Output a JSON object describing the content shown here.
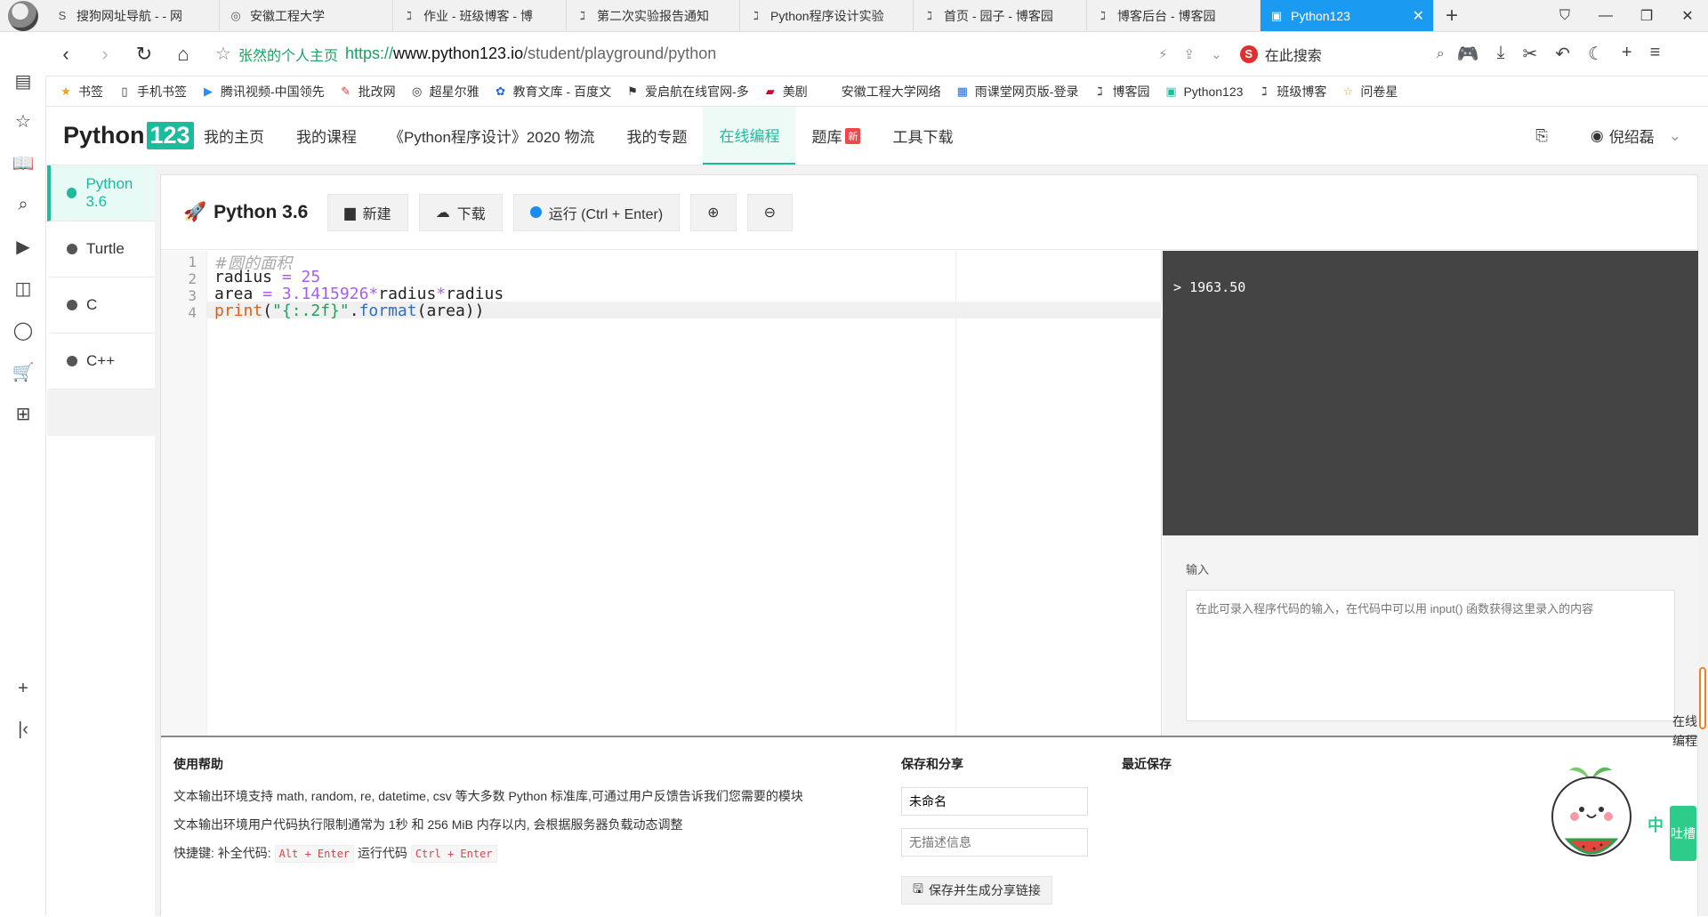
{
  "browser": {
    "tabs": [
      {
        "icon": "sogou-icon",
        "title": "搜狗网址导航 - - 网"
      },
      {
        "icon": "globe-icon",
        "title": "安徽工程大学"
      },
      {
        "icon": "cnblogs-icon",
        "title": "作业 - 班级博客 - 博"
      },
      {
        "icon": "cnblogs-icon",
        "title": "第二次实验报告通知"
      },
      {
        "icon": "cnblogs-icon",
        "title": "Python程序设计实验"
      },
      {
        "icon": "cnblogs-icon",
        "title": "首页 - 园子 - 博客园"
      },
      {
        "icon": "cnblogs-icon",
        "title": "博客后台 - 博客园"
      },
      {
        "icon": "python123-icon",
        "title": "Python123",
        "active": true
      }
    ],
    "site_title": "张然的个人主页",
    "url_proto": "https://",
    "url_host": "www.python123.io",
    "url_path": "/student/playground/python",
    "search_placeholder": "在此搜索",
    "bookmarks": [
      {
        "icon": "star-icon",
        "label": "书签"
      },
      {
        "icon": "phone-icon",
        "label": "手机书签"
      },
      {
        "icon": "tencent-video-icon",
        "label": "腾讯视频-中国领先"
      },
      {
        "icon": "pigai-icon",
        "label": "批改网"
      },
      {
        "icon": "globe-icon",
        "label": "超星尔雅"
      },
      {
        "icon": "baidu-icon",
        "label": "教育文库 - 百度文"
      },
      {
        "icon": "flag-icon",
        "label": "爱启航在线官网-多"
      },
      {
        "icon": "meiju-icon",
        "label": "美剧"
      },
      {
        "icon": "blank-icon",
        "label": "安徽工程大学网络"
      },
      {
        "icon": "rain-icon",
        "label": "雨课堂网页版-登录"
      },
      {
        "icon": "cnblogs-icon",
        "label": "博客园"
      },
      {
        "icon": "python123-icon",
        "label": "Python123"
      },
      {
        "icon": "cnblogs-icon",
        "label": "班级博客"
      },
      {
        "icon": "star-icon",
        "label": "问卷星"
      }
    ]
  },
  "site": {
    "logo_text": "Python",
    "logo_num": "123",
    "nav": [
      "我的主页",
      "我的课程",
      "《Python程序设计》2020 物流",
      "我的专题",
      "在线编程",
      "题库",
      "工具下载"
    ],
    "nav_active": "在线编程",
    "new_badge": "新",
    "username": "倪绍磊"
  },
  "languages": [
    {
      "label": "Python 3.6",
      "active": true
    },
    {
      "label": "Turtle"
    },
    {
      "label": "C"
    },
    {
      "label": "C++"
    }
  ],
  "toolbar": {
    "title": "Python 3.6",
    "new_label": "新建",
    "download_label": "下载",
    "run_label": "运行 (Ctrl + Enter)"
  },
  "editor": {
    "line_numbers": [
      "1",
      "2",
      "3",
      "4"
    ],
    "comment": "#圆的面积"
  },
  "output": {
    "prompt": ">",
    "result": "1963.50"
  },
  "input": {
    "label": "输入",
    "placeholder": "在此可录入程序代码的输入，在代码中可以用 input() 函数获得这里录入的内容"
  },
  "help": {
    "title": "使用帮助",
    "line1": "文本输出环境支持 math, random, re, datetime, csv 等大多数 Python 标准库,可通过用户反馈告诉我们您需要的模块",
    "line2": "文本输出环境用户代码执行限制通常为 1秒 和 256 MiB 内存以内, 会根据服务器负载动态调整",
    "shortcut_prefix": "快捷键: 补全代码:",
    "shortcut_complete": "Alt + Enter",
    "shortcut_run_label": "运行代码",
    "shortcut_run": "Ctrl + Enter"
  },
  "share": {
    "title": "保存和分享",
    "name_value": "未命名",
    "desc_placeholder": "无描述信息",
    "button_label": "保存并生成分享链接"
  },
  "recent": {
    "title": "最近保存"
  },
  "sidechat": {
    "vertical_label": "在线编程",
    "tucao": "吐槽",
    "ime": "中"
  }
}
